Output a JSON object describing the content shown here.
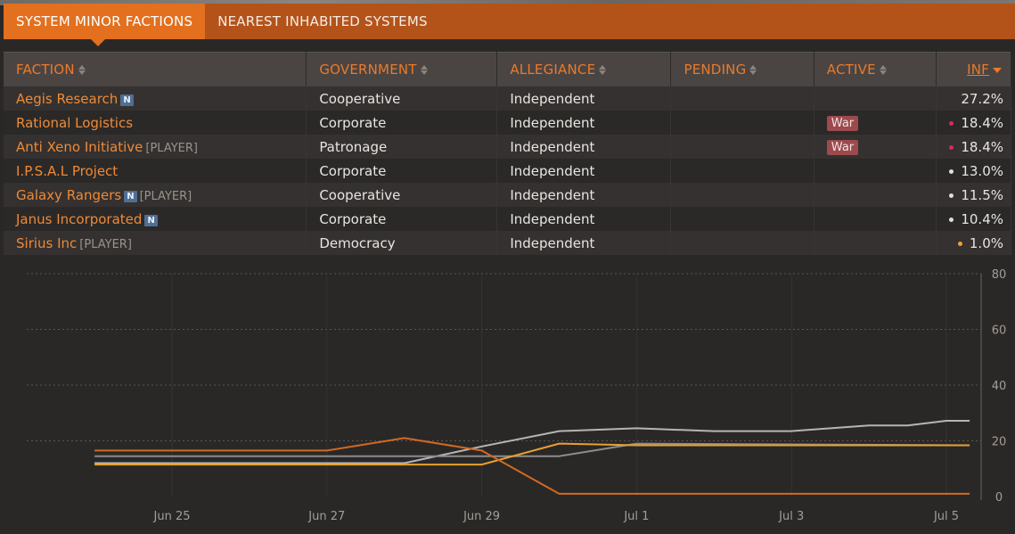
{
  "tabs": [
    {
      "label": "SYSTEM MINOR FACTIONS",
      "active": true
    },
    {
      "label": "NEAREST INHABITED SYSTEMS",
      "active": false
    }
  ],
  "table": {
    "headers": {
      "faction": "FACTION",
      "government": "GOVERNMENT",
      "allegiance": "ALLEGIANCE",
      "pending": "PENDING",
      "active": "ACTIVE",
      "inf": "INF"
    },
    "rows": [
      {
        "name": "Aegis Research",
        "n_badge": "N",
        "player": "",
        "government": "Cooperative",
        "allegiance": "Independent",
        "pending": "",
        "active": "",
        "inf": "27.2%",
        "dot": "",
        "dot_color": ""
      },
      {
        "name": "Rational Logistics",
        "n_badge": "",
        "player": "",
        "government": "Corporate",
        "allegiance": "Independent",
        "pending": "",
        "active": "War",
        "inf": "18.4%",
        "dot": "•",
        "dot_color": "#e0245e"
      },
      {
        "name": "Anti Xeno Initiative",
        "n_badge": "",
        "player": "[PLAYER]",
        "government": "Patronage",
        "allegiance": "Independent",
        "pending": "",
        "active": "War",
        "inf": "18.4%",
        "dot": "•",
        "dot_color": "#e0245e"
      },
      {
        "name": "I.P.S.A.L Project",
        "n_badge": "",
        "player": "",
        "government": "Corporate",
        "allegiance": "Independent",
        "pending": "",
        "active": "",
        "inf": "13.0%",
        "dot": "•",
        "dot_color": "#dedede"
      },
      {
        "name": "Galaxy Rangers",
        "n_badge": "N",
        "player": "[PLAYER]",
        "government": "Cooperative",
        "allegiance": "Independent",
        "pending": "",
        "active": "",
        "inf": "11.5%",
        "dot": "•",
        "dot_color": "#dedede"
      },
      {
        "name": "Janus Incorporated",
        "n_badge": "N",
        "player": "",
        "government": "Corporate",
        "allegiance": "Independent",
        "pending": "",
        "active": "",
        "inf": "10.4%",
        "dot": "•",
        "dot_color": "#dedede"
      },
      {
        "name": "Sirius Inc",
        "n_badge": "",
        "player": "[PLAYER]",
        "government": "Democracy",
        "allegiance": "Independent",
        "pending": "",
        "active": "",
        "inf": "1.0%",
        "dot": "•",
        "dot_color": "#f0a030"
      }
    ]
  },
  "chart_data": {
    "type": "line",
    "x_ticks": [
      "Jun 25",
      "Jun 27",
      "Jun 29",
      "Jul 1",
      "Jul 3",
      "Jul 5"
    ],
    "y_ticks": [
      "0",
      "20",
      "40",
      "60",
      "80"
    ],
    "ylim": [
      0,
      80
    ],
    "grid": true,
    "series": [
      {
        "color": "#b5b5b5",
        "x": [
          "Jun 24",
          "Jun 28",
          "Jun 29",
          "Jun 30",
          "Jul 1",
          "Jul 2",
          "Jul 3",
          "Jul 4",
          "Jul 4.5",
          "Jul 5",
          "Jul 5.3"
        ],
        "values": [
          12,
          12,
          18,
          23.5,
          24.5,
          23.5,
          23.5,
          25.5,
          25.5,
          27.2,
          27.2
        ]
      },
      {
        "color": "#8c8c8c",
        "x": [
          "Jun 24",
          "Jun 30",
          "Jul 1",
          "Jul 5.3"
        ],
        "values": [
          14.5,
          14.5,
          19,
          18.4
        ]
      },
      {
        "color": "#e8a030",
        "x": [
          "Jun 24",
          "Jun 29",
          "Jun 30",
          "Jul 1",
          "Jul 5.3"
        ],
        "values": [
          11.5,
          11.5,
          19,
          18.4,
          18.4
        ]
      },
      {
        "color": "#d06a22",
        "x": [
          "Jun 24",
          "Jun 27",
          "Jun 28",
          "Jun 29",
          "Jun 30",
          "Jul 5.3"
        ],
        "values": [
          16.5,
          16.5,
          21,
          16.5,
          1.0,
          1.0
        ]
      }
    ]
  }
}
